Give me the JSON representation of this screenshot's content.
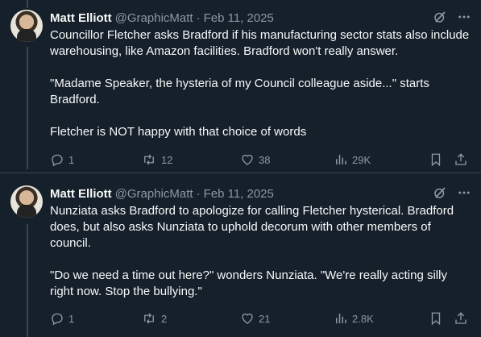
{
  "tweets": [
    {
      "author_name": "Matt Elliott",
      "handle": "@GraphicMatt",
      "separator": "·",
      "date": "Feb 11, 2025",
      "paragraphs": [
        "Councillor Fletcher asks Bradford if his manufacturing sector stats also include warehousing, like Amazon facilities. Bradford won't really answer.",
        "\"Madame Speaker, the hysteria of my Council colleague aside...\" starts Bradford.",
        "Fletcher is NOT happy with that choice of words"
      ],
      "replies": "1",
      "retweets": "12",
      "likes": "38",
      "views": "29K"
    },
    {
      "author_name": "Matt Elliott",
      "handle": "@GraphicMatt",
      "separator": "·",
      "date": "Feb 11, 2025",
      "paragraphs": [
        "Nunziata asks Bradford to apologize for calling Fletcher hysterical. Bradford does, but also asks Nunziata to uphold decorum with other members of council.",
        "\"Do we need a time out here?\" wonders Nunziata. \"We're really acting silly right now. Stop the bullying.\""
      ],
      "replies": "1",
      "retweets": "2",
      "likes": "21",
      "views": "2.8K"
    }
  ],
  "colors": {
    "background": "#15202b",
    "text": "#f7f9f9",
    "secondary": "#8b98a5",
    "divider": "#38444d"
  },
  "icons": [
    "grok-icon",
    "more-icon",
    "reply-icon",
    "retweet-icon",
    "like-icon",
    "views-icon",
    "bookmark-icon",
    "share-icon"
  ]
}
